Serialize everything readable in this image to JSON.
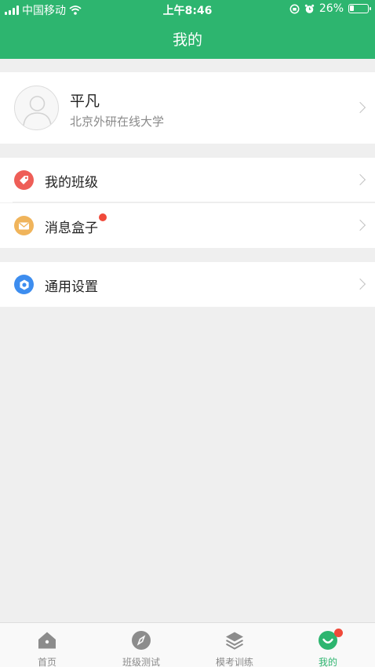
{
  "status_bar": {
    "carrier": "中国移动",
    "time": "上午8:46",
    "battery": "26%",
    "battery_level": 0.26
  },
  "header": {
    "title": "我的"
  },
  "profile": {
    "name": "平凡",
    "school": "北京外研在线大学",
    "avatar_icon": "user-avatar-placeholder-icon"
  },
  "menu": {
    "group1": [
      {
        "label": "我的班级",
        "icon": "tag-icon",
        "color": "#ee5e57"
      },
      {
        "label": "消息盒子",
        "icon": "mail-icon",
        "color": "#f0b45b",
        "badge": true
      }
    ],
    "group2": [
      {
        "label": "通用设置",
        "icon": "gear-icon",
        "color": "#3d8def"
      }
    ]
  },
  "tabbar": {
    "items": [
      {
        "label": "首页",
        "icon": "home-icon"
      },
      {
        "label": "班级测试",
        "icon": "compass-icon"
      },
      {
        "label": "模考训练",
        "icon": "layers-icon"
      },
      {
        "label": "我的",
        "icon": "profile-face-icon",
        "active": true,
        "badge": true
      }
    ]
  },
  "colors": {
    "brand": "#2db56f",
    "badge": "#f04a3a",
    "background": "#efefef"
  }
}
